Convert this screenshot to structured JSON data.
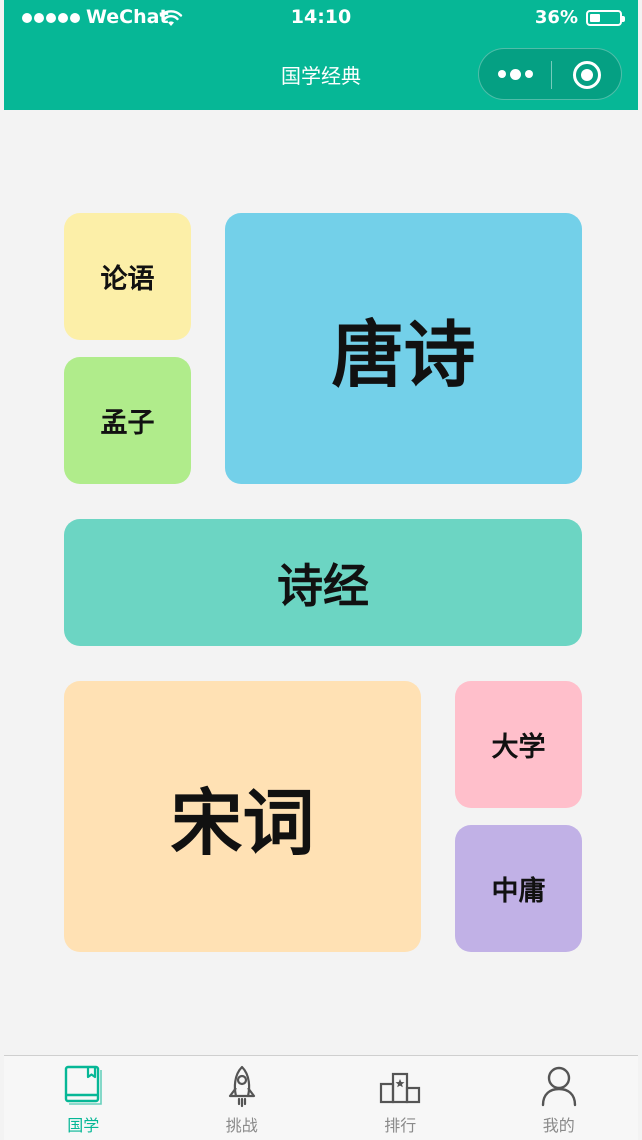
{
  "status_bar": {
    "carrier": "WeChat",
    "time": "14:10",
    "battery_percent": "36%",
    "battery_level": 0.36
  },
  "nav": {
    "title": "国学经典",
    "capsule": {
      "more_icon": "more-dots-icon",
      "close_icon": "close-circle-icon"
    }
  },
  "colors": {
    "brand": "#06b796",
    "tile_lunyu": "#fcefa8",
    "tile_mengzi": "#b0ec8b",
    "tile_tangshi": "#73d0e9",
    "tile_shijing": "#6cd5c3",
    "tile_songci": "#ffe1b4",
    "tile_daxue": "#ffbfcb",
    "tile_zhongyong": "#c1b1e6"
  },
  "tiles": {
    "lunyu": "论语",
    "mengzi": "孟子",
    "tangshi": "唐诗",
    "shijing": "诗经",
    "songci": "宋词",
    "daxue": "大学",
    "zhongyong": "中庸"
  },
  "tabbar": {
    "items": [
      {
        "label": "国学",
        "icon": "book-icon",
        "active": true
      },
      {
        "label": "挑战",
        "icon": "rocket-icon",
        "active": false
      },
      {
        "label": "排行",
        "icon": "podium-icon",
        "active": false
      },
      {
        "label": "我的",
        "icon": "user-icon",
        "active": false
      }
    ]
  }
}
